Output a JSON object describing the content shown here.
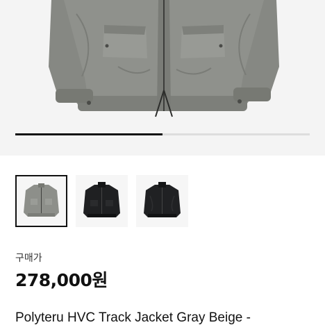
{
  "gallery": {
    "main_image": "gray-jacket-photo",
    "progress": 0.5,
    "thumbnails": [
      {
        "name": "gray-jacket-thumb",
        "selected": true
      },
      {
        "name": "black-jacket-thumb-1",
        "selected": false
      },
      {
        "name": "black-jacket-thumb-2",
        "selected": false
      }
    ]
  },
  "product": {
    "price_label": "구매가",
    "price": "278,000원",
    "title": "Polyteru HVC Track Jacket Gray Beige -"
  },
  "colors": {
    "background": "#ffffff",
    "hero_background": "#f4f4f4",
    "jacket_gray": "#8f918c",
    "jacket_black": "#1e1f21",
    "pager_active": "#111111",
    "pager_track": "#dddddd"
  }
}
